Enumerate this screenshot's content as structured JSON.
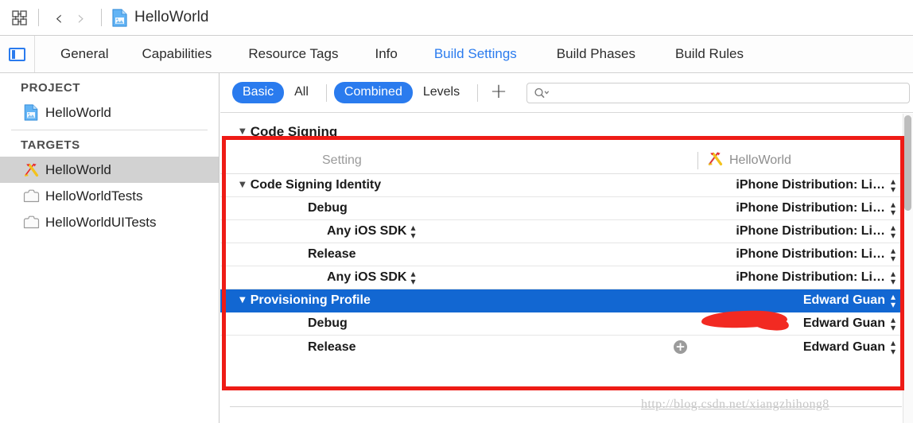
{
  "toolbar": {
    "grid_icon": "grid-view-icon",
    "back_icon": "chevron-left-icon",
    "forward_icon": "chevron-right-icon",
    "doc_icon": "project-document-icon",
    "title": "HelloWorld"
  },
  "tabbar": {
    "panel_icon": "toggle-navigator-icon",
    "tabs": [
      {
        "label": "General",
        "active": false
      },
      {
        "label": "Capabilities",
        "active": false
      },
      {
        "label": "Resource Tags",
        "active": false
      },
      {
        "label": "Info",
        "active": false
      },
      {
        "label": "Build Settings",
        "active": true
      },
      {
        "label": "Build Phases",
        "active": false
      },
      {
        "label": "Build Rules",
        "active": false
      }
    ]
  },
  "sidebar": {
    "project_header": "PROJECT",
    "targets_header": "TARGETS",
    "project_items": [
      {
        "label": "HelloWorld",
        "icon": "project-document-icon",
        "selected": false
      }
    ],
    "target_items": [
      {
        "label": "HelloWorld",
        "icon": "xcode-app-icon",
        "selected": true
      },
      {
        "label": "HelloWorldTests",
        "icon": "test-bundle-icon",
        "selected": false
      },
      {
        "label": "HelloWorldUITests",
        "icon": "test-bundle-icon",
        "selected": false
      }
    ]
  },
  "filterbar": {
    "pills": [
      {
        "label": "Basic",
        "on": true
      },
      {
        "label": "All",
        "on": false
      },
      {
        "label": "Combined",
        "on": true
      },
      {
        "label": "Levels",
        "on": false
      }
    ],
    "add_label": "+",
    "search_icon": "search-icon",
    "search_value": "",
    "search_placeholder": ""
  },
  "settings": {
    "group_title": "Code Signing",
    "column_setting": "Setting",
    "column_target": "HelloWorld",
    "column_target_icon": "xcode-app-icon",
    "rows": [
      {
        "name": "Code Signing Identity",
        "level": 0,
        "disclosure": true,
        "value": "iPhone Distribution: Li…",
        "stepper": true,
        "selected": false,
        "name_stepper": false,
        "plus": false
      },
      {
        "name": "Debug",
        "level": 1,
        "disclosure": false,
        "value": "iPhone Distribution: Li…",
        "stepper": true,
        "selected": false,
        "name_stepper": false,
        "plus": false
      },
      {
        "name": "Any iOS SDK",
        "level": 2,
        "disclosure": false,
        "value": "iPhone Distribution: Li…",
        "stepper": true,
        "selected": false,
        "name_stepper": true,
        "plus": false
      },
      {
        "name": "Release",
        "level": 1,
        "disclosure": false,
        "value": "iPhone Distribution: Li…",
        "stepper": true,
        "selected": false,
        "name_stepper": false,
        "plus": false
      },
      {
        "name": "Any iOS SDK",
        "level": 2,
        "disclosure": false,
        "value": "iPhone Distribution: Li…",
        "stepper": true,
        "selected": false,
        "name_stepper": true,
        "plus": false
      },
      {
        "name": "Provisioning Profile",
        "level": 0,
        "disclosure": true,
        "value": "Edward Guan",
        "stepper": true,
        "selected": true,
        "name_stepper": false,
        "plus": false
      },
      {
        "name": "Debug",
        "level": 1,
        "disclosure": false,
        "value": "Edward Guan",
        "stepper": true,
        "selected": false,
        "name_stepper": false,
        "plus": false
      },
      {
        "name": "Release",
        "level": 1,
        "disclosure": false,
        "value": "Edward Guan",
        "stepper": true,
        "selected": false,
        "name_stepper": false,
        "plus": true
      }
    ]
  },
  "annotations": {
    "box_color": "#ee1b16",
    "scribble_color": "#f22a22"
  },
  "watermark": {
    "text": "http://blog.csdn.net/xiangzhihong8"
  }
}
